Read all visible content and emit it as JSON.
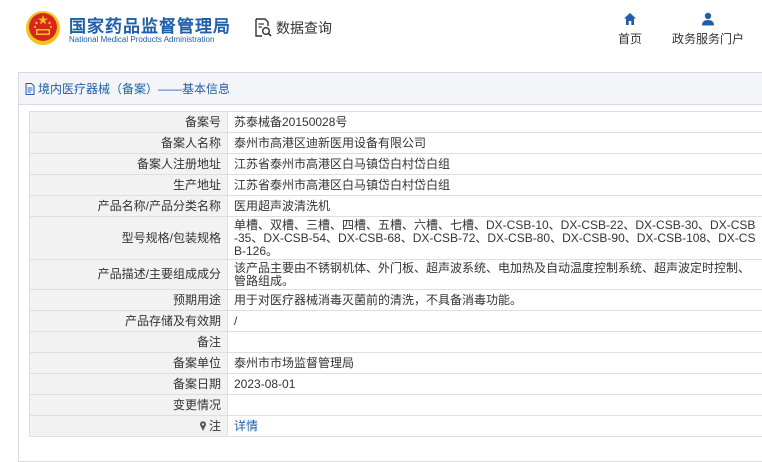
{
  "header": {
    "brand_cn": "国家药品监督管理局",
    "brand_en": "National Medical Products Administration",
    "query_label": "数据查询",
    "nav": {
      "home": "首页",
      "portal": "政务服务门户"
    }
  },
  "colors": {
    "brand_blue": "#1f5faa",
    "emblem_red": "#d7261e",
    "emblem_gold": "#f2c31a",
    "label_bg": "#f2f2f2"
  },
  "panel": {
    "title": "境内医疗器械（备案）——基本信息"
  },
  "rows": [
    {
      "label": "备案号",
      "value": "苏泰械备20150028号"
    },
    {
      "label": "备案人名称",
      "value": "泰州市高港区迪新医用设备有限公司"
    },
    {
      "label": "备案人注册地址",
      "value": "江苏省泰州市高港区白马镇岱白村岱白组"
    },
    {
      "label": "生产地址",
      "value": "江苏省泰州市高港区白马镇岱白村岱白组"
    },
    {
      "label": "产品名称/产品分类名称",
      "value": "医用超声波清洗机"
    },
    {
      "label": "型号规格/包装规格",
      "value": "单槽、双槽、三槽、四槽、五槽、六槽、七槽、DX-CSB-10、DX-CSB-22、DX-CSB-30、DX-CSB-35、DX-CSB-54、DX-CSB-68、DX-CSB-72、DX-CSB-80、DX-CSB-90、DX-CSB-108、DX-CSB-126。"
    },
    {
      "label": "产品描述/主要组成成分",
      "value": "该产品主要由不锈钢机体、外门板、超声波系统、电加热及自动温度控制系统、超声波定时控制、管路组成。"
    },
    {
      "label": "预期用途",
      "value": "用于对医疗器械消毒灭菌前的清洗，不具备消毒功能。"
    },
    {
      "label": "产品存储及有效期",
      "value": "/"
    },
    {
      "label": "备注",
      "value": ""
    },
    {
      "label": "备案单位",
      "value": "泰州市市场监督管理局"
    },
    {
      "label": "备案日期",
      "value": "2023-08-01"
    },
    {
      "label": "变更情况",
      "value": ""
    },
    {
      "label": "注",
      "value": "详情"
    }
  ],
  "icons": {
    "query": "data-query-icon",
    "home": "home-icon",
    "portal": "user-icon",
    "panel": "document-icon",
    "note": "pin-icon"
  }
}
